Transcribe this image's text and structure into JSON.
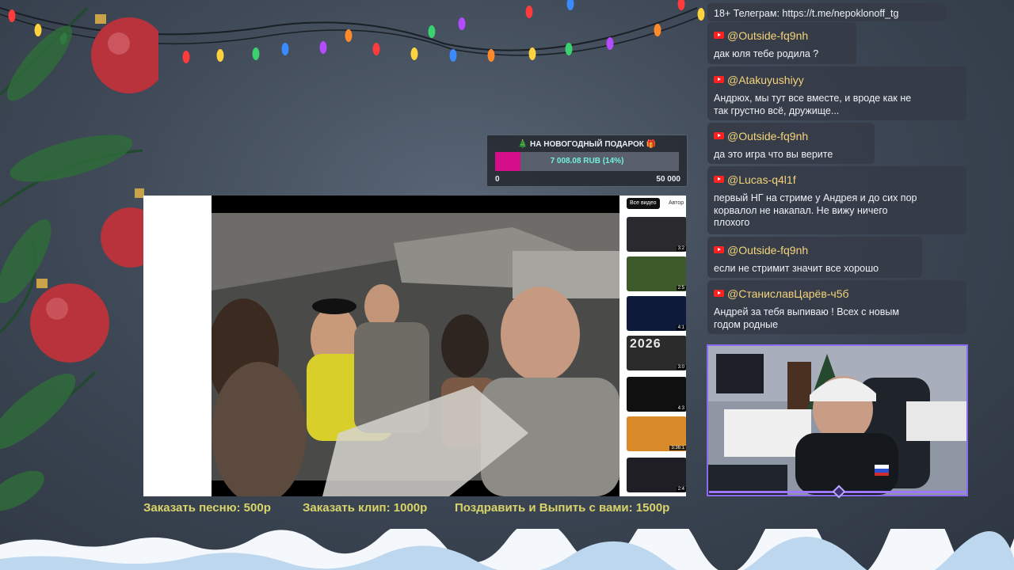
{
  "donation_goal": {
    "title": "🎄 НА НОВОГОДНЫЙ ПОДАРОК 🎁",
    "amount": "7 008.08 RUB (14%)",
    "progress_fraction": 0.14,
    "min_label": "0",
    "max_label": "50 000",
    "fill_color": "#d3108a",
    "amount_color": "#6ff0e0"
  },
  "browser": {
    "chips": [
      "Все видео",
      "Автор"
    ],
    "thumbnails": [
      {
        "duration": "3:2"
      },
      {
        "duration": "2:5"
      },
      {
        "duration": "4:1"
      },
      {
        "duration": "3:0",
        "caption": "2026"
      },
      {
        "duration": "4:3"
      },
      {
        "duration": "3:36:1"
      },
      {
        "duration": "2:4"
      }
    ]
  },
  "prices": {
    "song": "Заказать песню: 500р",
    "clip": "Заказать клип: 1000р",
    "congrats": "Поздравить и Выпить с вами: 1500р",
    "color": "#d9d46a"
  },
  "chat": {
    "pinned_text": "18+ Телеграм: https://t.me/nepoklonoff_tg",
    "messages": [
      {
        "author": "@Outside-fq9nh",
        "lines": [
          "дак юля тебе родила ?"
        ]
      },
      {
        "author": "@Atakuyushiyy",
        "lines": [
          "Андрюх, мы тут все вместе, и вроде как не",
          "так грустно всё, дружище..."
        ]
      },
      {
        "author": "@Outside-fq9nh",
        "lines": [
          "да это игра что вы верите"
        ]
      },
      {
        "author": "@Lucas-q4l1f",
        "lines": [
          "первый НГ на стриме у Андрея и до сих пор",
          "корвалол не накапал. Не вижу ничего",
          "плохого"
        ]
      },
      {
        "author": "@Outside-fq9nh",
        "lines": [
          "если не стримит значит все хорошо"
        ]
      },
      {
        "author": "@СтаниславЦарёв-ч5б",
        "lines": [
          "Андрей за тебя выпиваю ! Всех с новым",
          "годом родные"
        ]
      }
    ],
    "author_color": "#f4d37a"
  },
  "webcam": {
    "border_color": "#8b6cf0"
  }
}
